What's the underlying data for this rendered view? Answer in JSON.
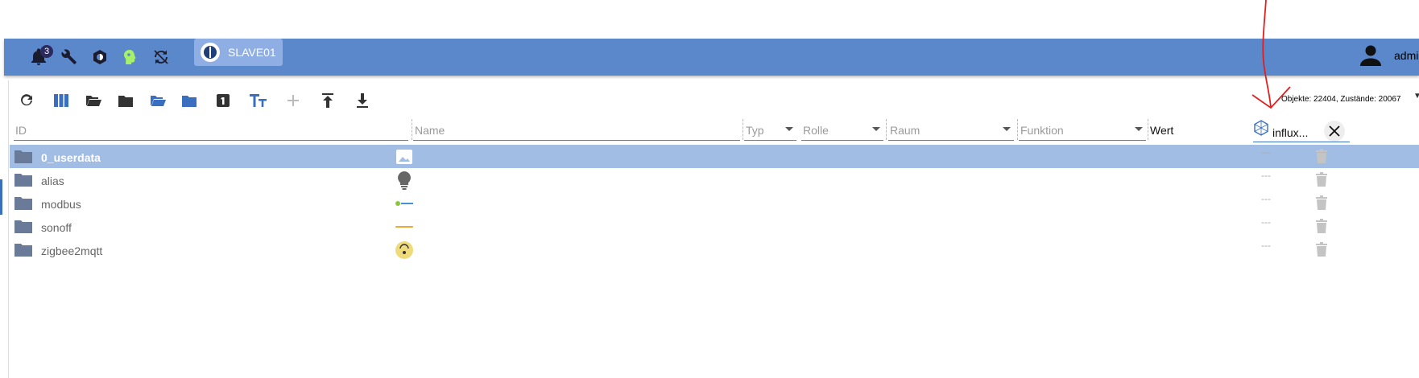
{
  "header": {
    "notification_count": "3",
    "instance_label": "SLAVE01",
    "user_name": "admin",
    "icons": [
      "bell-icon",
      "wrench-icon",
      "gear-icon",
      "head-icon",
      "sync-disabled-icon"
    ]
  },
  "toolbar": {
    "icons": [
      "refresh-icon",
      "columns-icon",
      "folder-open-icon",
      "folder-icon",
      "folder-open-blue-icon",
      "folder-blue-icon",
      "number-one-icon",
      "text-size-icon",
      "add-icon",
      "upload-icon",
      "download-icon"
    ],
    "stats": "Objekte: 22404, Zustände: 20067"
  },
  "filters": {
    "id_placeholder": "ID",
    "name_placeholder": "Name",
    "type_placeholder": "Typ",
    "role_placeholder": "Rolle",
    "room_placeholder": "Raum",
    "function_placeholder": "Funktion",
    "value_label": "Wert",
    "influx_label": "influx..."
  },
  "rows": [
    {
      "name": "0_userdata",
      "icon": "image-icon",
      "dots": "---",
      "selected": true
    },
    {
      "name": "alias",
      "icon": "lightbulb-icon",
      "dots": "---"
    },
    {
      "name": "modbus",
      "icon": "modbus-logo",
      "dots": "---"
    },
    {
      "name": "sonoff",
      "icon": "sonoff-logo",
      "dots": "---"
    },
    {
      "name": "zigbee2mqtt",
      "icon": "zigbee-logo",
      "dots": "---"
    }
  ],
  "colors": {
    "header_bg": "#5b87cb",
    "selected_row": "#a1bde4",
    "accent": "#3a6fc0",
    "annotation": "#e02020"
  }
}
